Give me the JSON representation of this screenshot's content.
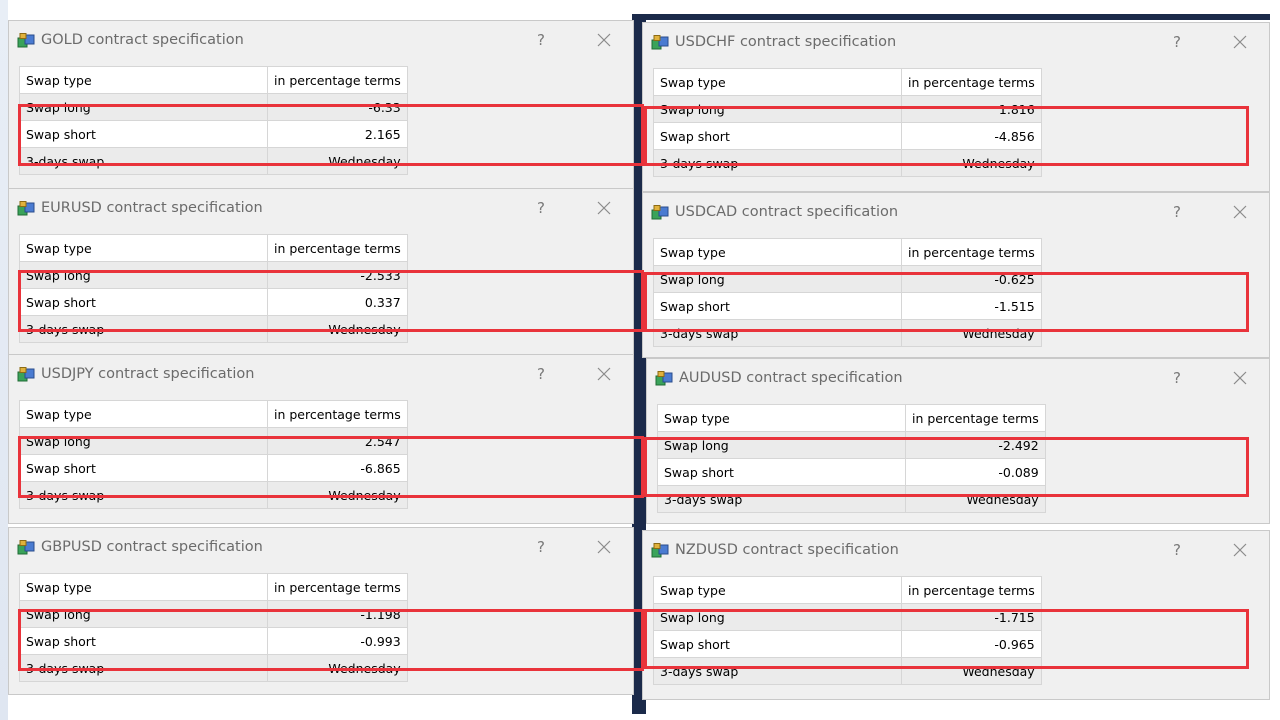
{
  "labels": {
    "swap_type": "Swap type",
    "swap_long": "Swap long",
    "swap_short": "Swap short",
    "three_days": "3-days swap"
  },
  "dialogs": [
    {
      "title": "GOLD contract specification",
      "help": "?",
      "swap_type": "in percentage terms",
      "swap_long": "-6.33",
      "swap_short": "2.165",
      "three_days": "Wednesday"
    },
    {
      "title": "USDCHF contract specification",
      "help": "?",
      "swap_type": "in percentage terms",
      "swap_long": "1.816",
      "swap_short": "-4.856",
      "three_days": "Wednesday"
    },
    {
      "title": "EURUSD contract specification",
      "help": "?",
      "swap_type": "in percentage terms",
      "swap_long": "-2.533",
      "swap_short": "0.337",
      "three_days": "Wednesday"
    },
    {
      "title": "USDCAD contract specification",
      "help": "?",
      "swap_type": "in percentage terms",
      "swap_long": "-0.625",
      "swap_short": "-1.515",
      "three_days": "Wednesday"
    },
    {
      "title": "USDJPY contract specification",
      "help": "?",
      "swap_type": "in percentage terms",
      "swap_long": "2.547",
      "swap_short": "-6.865",
      "three_days": "Wednesday"
    },
    {
      "title": "AUDUSD contract specification",
      "help": "?",
      "swap_type": "in percentage terms",
      "swap_long": "-2.492",
      "swap_short": "-0.089",
      "three_days": "Wednesday"
    },
    {
      "title": "GBPUSD contract specification",
      "help": "?",
      "swap_type": "in percentage terms",
      "swap_long": "-1.198",
      "swap_short": "-0.993",
      "three_days": "Wednesday"
    },
    {
      "title": "NZDUSD contract specification",
      "help": "?",
      "swap_type": "in percentage terms",
      "swap_long": "-1.715",
      "swap_short": "-0.965",
      "three_days": "Wednesday"
    }
  ],
  "icons": {
    "app": "app-package-icon",
    "close": "close-icon"
  },
  "colors": {
    "highlight": "#e9333b",
    "title_text": "#6b6b6b"
  }
}
